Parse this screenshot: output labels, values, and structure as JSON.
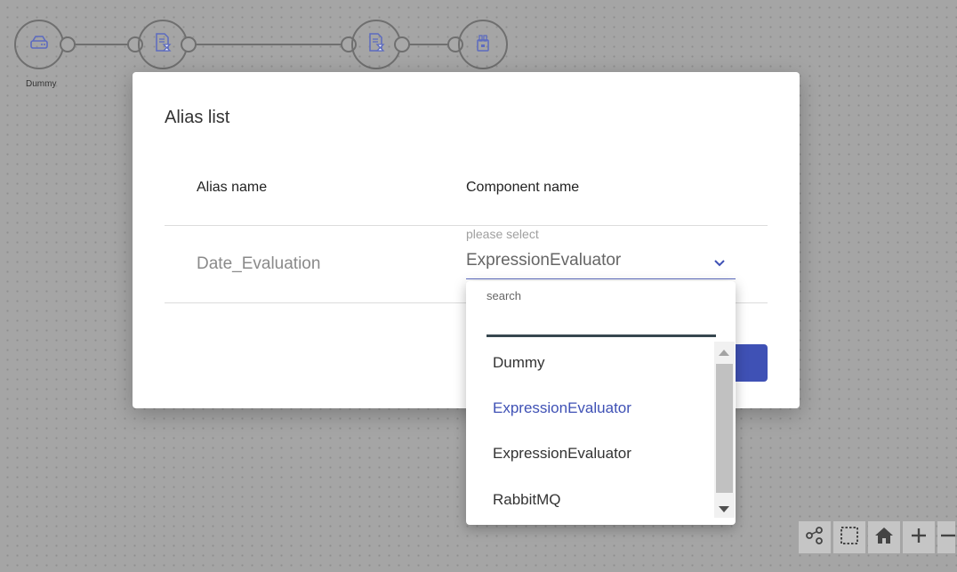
{
  "canvas": {
    "nodes": [
      {
        "icon": "drive-icon",
        "label": "Dummy"
      },
      {
        "icon": "document-hourglass-icon",
        "label": ""
      },
      {
        "icon": "document-hourglass-icon",
        "label": ""
      },
      {
        "icon": "plug-icon",
        "label": ""
      }
    ]
  },
  "dialog": {
    "title": "Alias list",
    "columns": {
      "alias": "Alias name",
      "component": "Component name"
    },
    "rows": [
      {
        "alias": "Date_Evaluation",
        "select_label": "please select",
        "select_value": "ExpressionEvaluator"
      }
    ]
  },
  "dropdown": {
    "search_label": "search",
    "search_value": "",
    "options": [
      {
        "label": "Dummy",
        "selected": false
      },
      {
        "label": "ExpressionEvaluator",
        "selected": true
      },
      {
        "label": "ExpressionEvaluator",
        "selected": false
      },
      {
        "label": "RabbitMQ",
        "selected": false
      }
    ]
  },
  "toolbar": {
    "tools": [
      "nodes-icon",
      "select-area-icon",
      "home-icon",
      "zoom-in-icon",
      "zoom-out-icon"
    ]
  },
  "colors": {
    "accent": "#3f51b5",
    "canvas_bg": "#a5a5a5",
    "node_stroke": "#6f6f6f"
  }
}
